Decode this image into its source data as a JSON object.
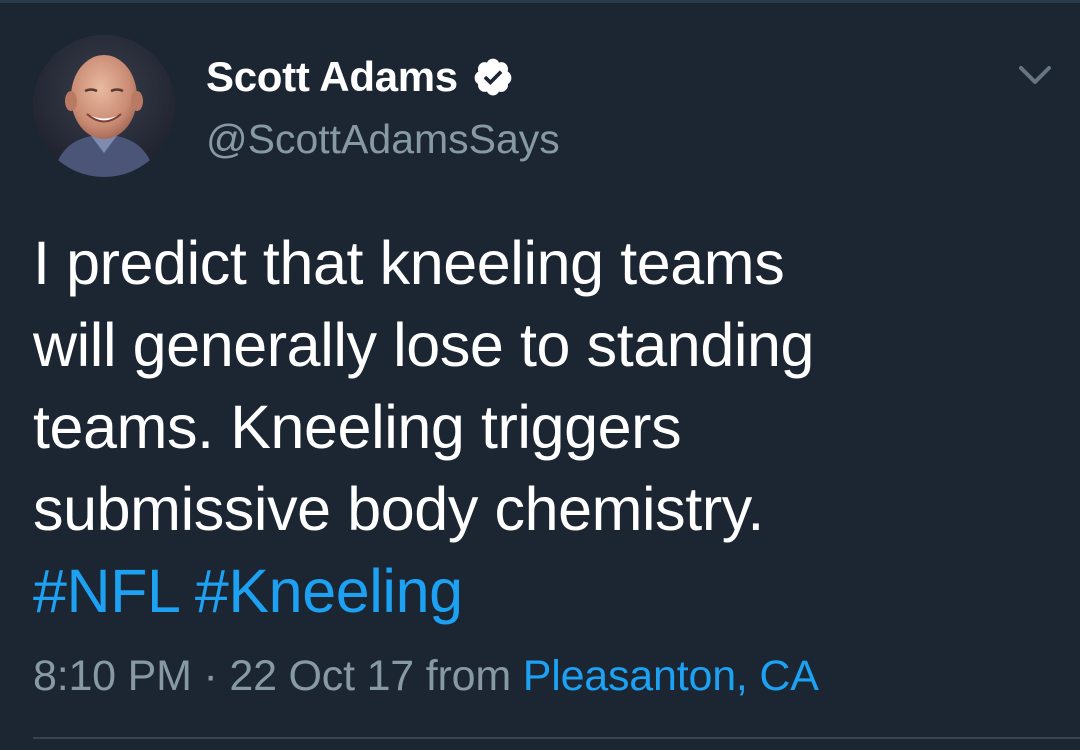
{
  "user": {
    "display_name": "Scott Adams",
    "handle": "@ScottAdamsSays",
    "verified": true,
    "avatar": "profile-photo"
  },
  "tweet": {
    "lines": [
      "I predict that kneeling teams",
      "will generally lose to standing",
      "teams. Kneeling triggers",
      "submissive body chemistry."
    ],
    "hashtags": [
      "#NFL",
      "#Kneeling"
    ],
    "time": "8:10 PM",
    "separator": " · ",
    "date": "22 Oct 17",
    "from_label": " from ",
    "location": "Pleasanton, CA"
  },
  "icons": {
    "verified": "verified-badge-icon",
    "menu": "chevron-down-icon"
  },
  "colors": {
    "background": "#1c2633",
    "text": "#ffffff",
    "secondary": "#8899a6",
    "accent": "#1da1f2"
  }
}
